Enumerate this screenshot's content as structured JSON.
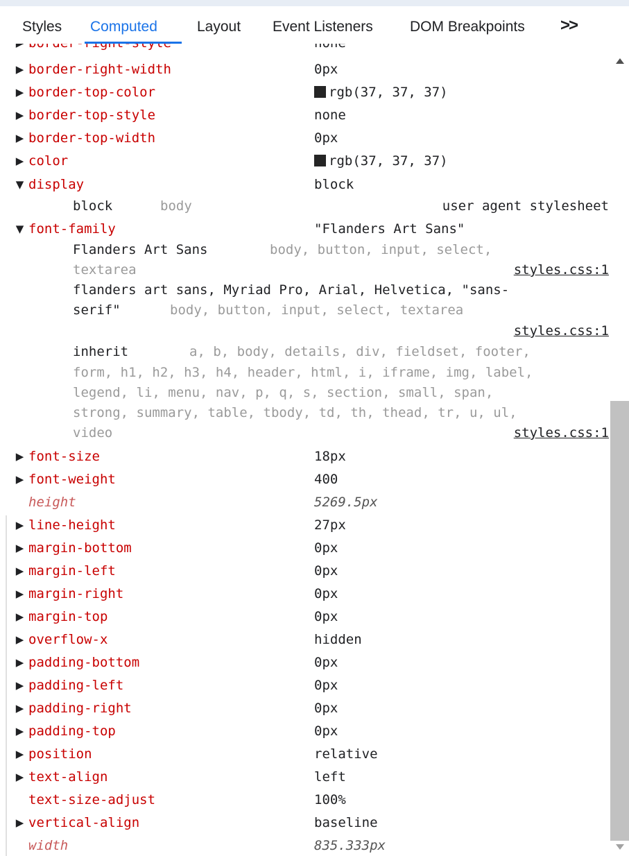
{
  "tabs": [
    {
      "label": "Styles",
      "active": false
    },
    {
      "label": "Computed",
      "active": true
    },
    {
      "label": "Layout",
      "active": false
    },
    {
      "label": "Event Listeners",
      "active": false
    },
    {
      "label": "DOM Breakpoints",
      "active": false
    }
  ],
  "more_tabs_icon": "double-chevron-right-icon",
  "colors": {
    "accent": "#1a73e8",
    "property": "#c80000",
    "inherited_property": "#c85a5a",
    "swatch": "#252525"
  },
  "partial_row": {
    "name": "border-right-style",
    "value": "none"
  },
  "properties_top": [
    {
      "name": "border-right-width",
      "value": "0px"
    },
    {
      "name": "border-top-color",
      "value": "rgb(37, 37, 37)"
    },
    {
      "name": "border-top-style",
      "value": "none"
    },
    {
      "name": "border-top-width",
      "value": "0px"
    },
    {
      "name": "color",
      "value": "rgb(37, 37, 37)"
    },
    {
      "name": "display",
      "value": "block"
    }
  ],
  "display_trace": {
    "value": "block",
    "selector": "body",
    "source": "user agent stylesheet"
  },
  "font_family": {
    "name": "font-family",
    "value": "\"Flanders Art Sans\"",
    "trace1": {
      "value": "Flanders Art Sans",
      "selector_line1": "body, button, input, select,",
      "selector_line2": "textarea",
      "source": "styles.css:1"
    },
    "trace2": {
      "value_line1": "flanders art sans, Myriad Pro, Arial, Helvetica, \"sans-",
      "value_line2": "serif\"",
      "selector": "body, button, input, select, textarea",
      "source": "styles.css:1"
    },
    "trace3": {
      "value": "inherit",
      "selector_line1": "a, b, body, details, div, fieldset, footer,",
      "selector_line2": "form, h1, h2, h3, h4, header, html, i, iframe, img, label,",
      "selector_line3": "legend, li, menu, nav, p, q, s, section, small, span,",
      "selector_line4": "strong, summary, table, tbody, td, th, thead, tr, u, ul,",
      "selector_line5": "video",
      "source": "styles.css:1"
    }
  },
  "properties_bottom": [
    {
      "name": "font-size",
      "value": "18px"
    },
    {
      "name": "font-weight",
      "value": "400"
    },
    {
      "name": "height",
      "value": "5269.5px"
    },
    {
      "name": "line-height",
      "value": "27px"
    },
    {
      "name": "margin-bottom",
      "value": "0px"
    },
    {
      "name": "margin-left",
      "value": "0px"
    },
    {
      "name": "margin-right",
      "value": "0px"
    },
    {
      "name": "margin-top",
      "value": "0px"
    },
    {
      "name": "overflow-x",
      "value": "hidden"
    },
    {
      "name": "padding-bottom",
      "value": "0px"
    },
    {
      "name": "padding-left",
      "value": "0px"
    },
    {
      "name": "padding-right",
      "value": "0px"
    },
    {
      "name": "padding-top",
      "value": "0px"
    },
    {
      "name": "position",
      "value": "relative"
    },
    {
      "name": "text-align",
      "value": "left"
    },
    {
      "name": "text-size-adjust",
      "value": "100%"
    },
    {
      "name": "vertical-align",
      "value": "baseline"
    },
    {
      "name": "width",
      "value": "835.333px"
    }
  ]
}
